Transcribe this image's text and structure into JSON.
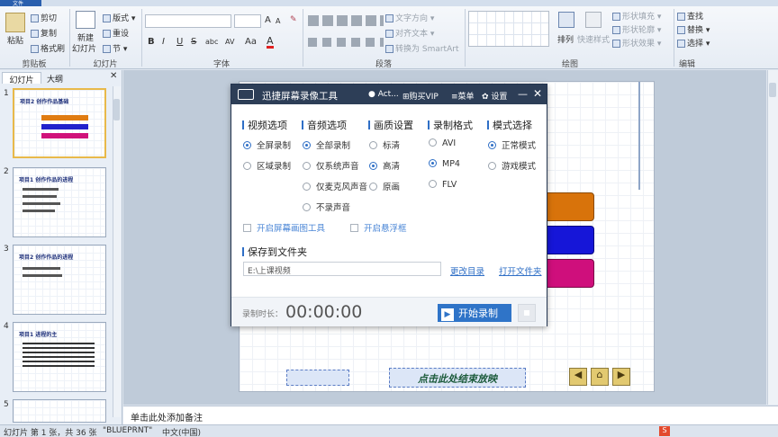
{
  "ribbon": {
    "tab_file": "文件",
    "clipboard": {
      "paste": "粘贴",
      "cut": "剪切",
      "copy": "复制",
      "format_painter": "格式刷",
      "label": "剪贴板"
    },
    "slides": {
      "new_slide": "新建",
      "new_slide2": "幻灯片",
      "layout": "版式",
      "reset": "重设",
      "section": "节",
      "label": "幻灯片"
    },
    "font": {
      "label": "字体",
      "grow": "A",
      "shrink": "A",
      "bold": "B",
      "italic": "I",
      "underline": "U",
      "strike": "S",
      "shadow": "abc",
      "spacing": "AV",
      "case": "Aa",
      "color": "A"
    },
    "paragraph": {
      "text_direction": "文字方向",
      "align_text": "对齐文本",
      "smartart": "转换为 SmartArt",
      "label": "段落"
    },
    "drawing": {
      "arrange": "排列",
      "quick_styles": "快速样式",
      "shape_fill": "形状填充",
      "shape_outline": "形状轮廓",
      "shape_effects": "形状效果",
      "label": "绘图"
    },
    "editing": {
      "find": "查找",
      "replace": "替换",
      "select": "选择",
      "label": "编辑"
    }
  },
  "pane": {
    "tab_slides": "幻灯片",
    "tab_outline": "大纲",
    "slide_nums": [
      "1",
      "2",
      "3",
      "4",
      "5"
    ],
    "thumb1_title": "项目2 创作作品基础",
    "thumb2_title": "项目1 创作作品的进程",
    "thumb3_title": "项目2 创作作品的进程",
    "thumb4_title": "项目1 进程的主"
  },
  "slide": {
    "footer_text": "点击此处结束放映"
  },
  "notes": {
    "placeholder": "单击此处添加备注"
  },
  "status": {
    "slide_info": "幻灯片 第 1 张，共 36 张",
    "theme": "\"BLUEPRNT\"",
    "lang": "中文(中国)"
  },
  "dialog": {
    "title": "迅捷屏幕录像工具",
    "account": "Act...",
    "buy_vip": "购买VIP",
    "menu": "菜单",
    "settings": "设置",
    "video_head": "视频选项",
    "audio_head": "音频选项",
    "quality_head": "画质设置",
    "format_head": "录制格式",
    "mode_head": "模式选择",
    "video_opts": [
      "全屏录制",
      "区域录制"
    ],
    "audio_opts": [
      "全部录制",
      "仅系统声音",
      "仅麦克风声音",
      "不录声音"
    ],
    "quality_opts": [
      "标清",
      "高清",
      "原画"
    ],
    "format_opts": [
      "AVI",
      "MP4",
      "FLV"
    ],
    "mode_opts": [
      "正常模式",
      "游戏模式"
    ],
    "chk_draw": "开启屏幕画图工具",
    "chk_float": "开启悬浮框",
    "save_head": "保存到文件夹",
    "save_path": "E:\\上课视频",
    "change_dir": "更改目录",
    "open_dir": "打开文件夹",
    "rec_label": "录制时长：",
    "rec_time": "00:00:00",
    "start": "开始录制"
  }
}
